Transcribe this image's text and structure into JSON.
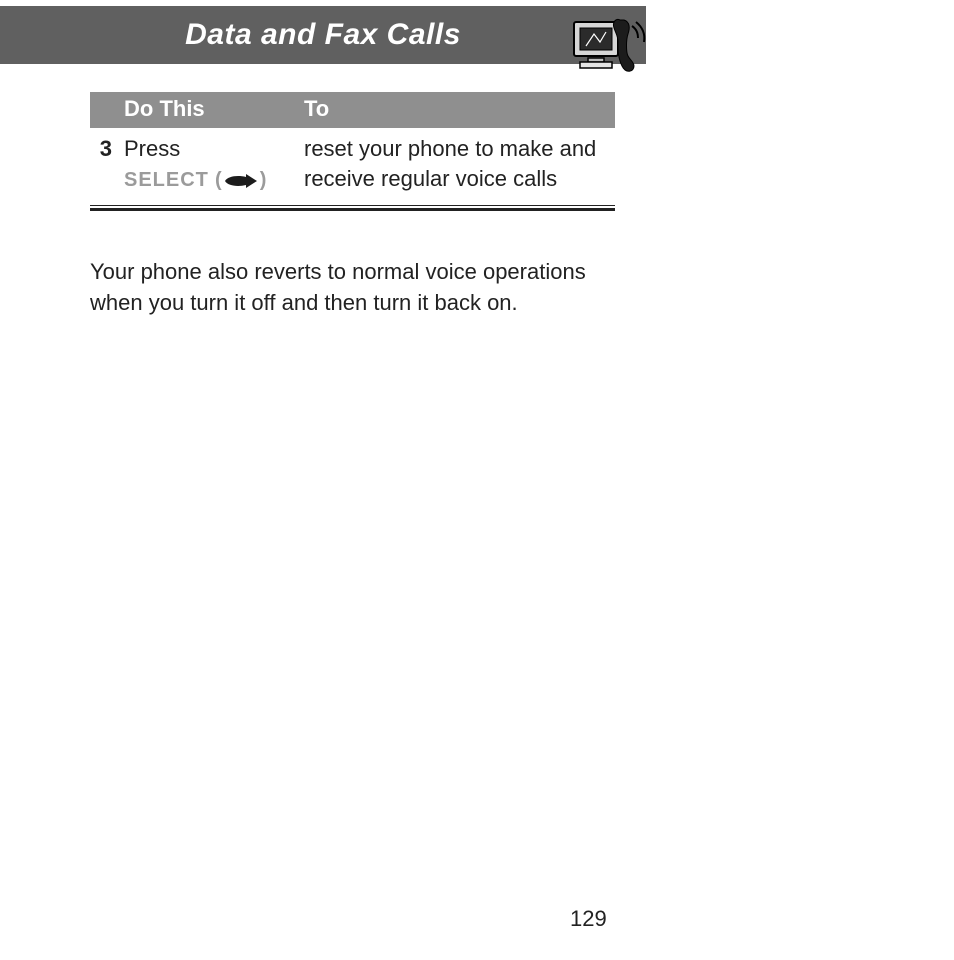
{
  "header": {
    "title": "Data and Fax Calls"
  },
  "table": {
    "headers": {
      "num": "",
      "do_this": "Do This",
      "to": "To"
    },
    "row": {
      "num": "3",
      "action_line1": "Press",
      "action_key": "SELECT",
      "action_paren_open": "(",
      "action_paren_close": ")",
      "result": "reset your phone to make and receive regular voice calls"
    }
  },
  "body": {
    "paragraph": "Your phone also reverts to normal voice operations when you turn it off and then turn it back on."
  },
  "page_number": "129"
}
